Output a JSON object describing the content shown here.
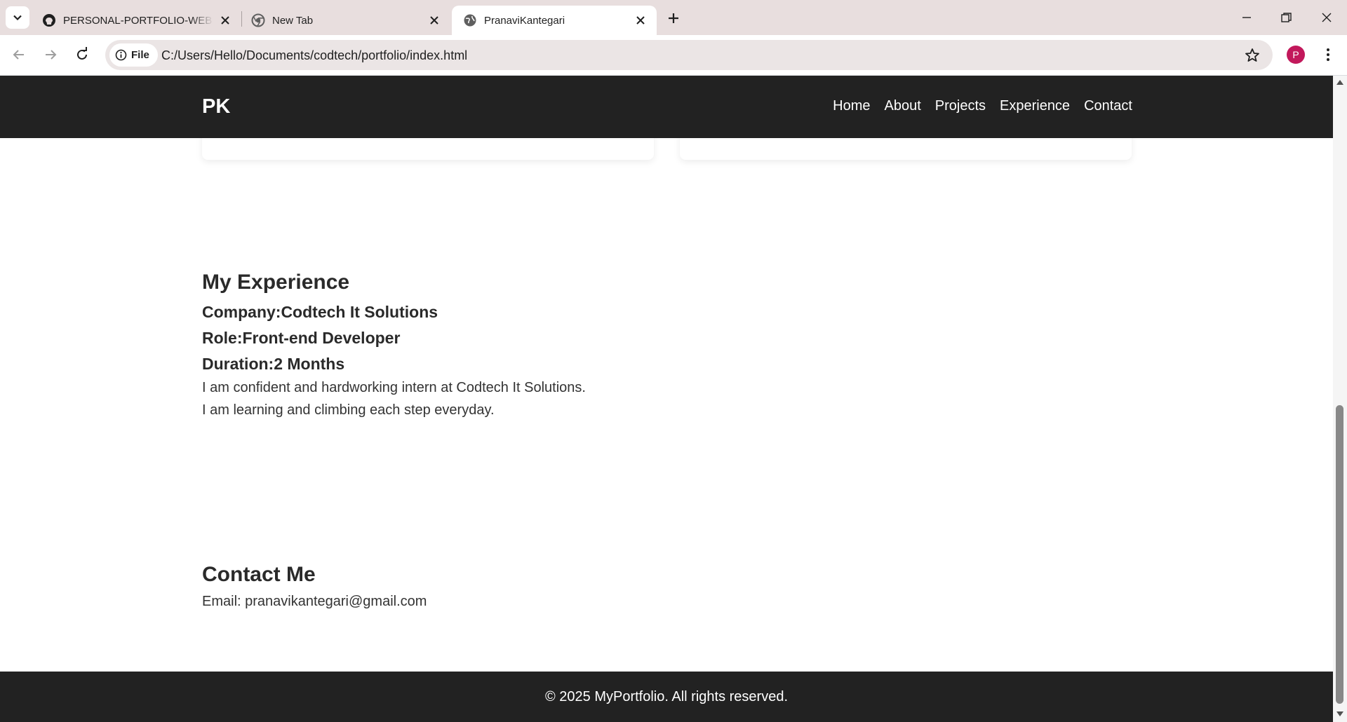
{
  "browser": {
    "tabs": [
      {
        "title": "PERSONAL-PORTFOLIO-WEBPAGE",
        "favicon": "github-icon",
        "active": false
      },
      {
        "title": "New Tab",
        "favicon": "chrome-icon",
        "active": false
      },
      {
        "title": "PranaviKantegari",
        "favicon": "globe-icon",
        "active": true
      }
    ],
    "chip_label": "File",
    "url": "C:/Users/Hello/Documents/codtech/portfolio/index.html",
    "profile_initial": "P",
    "profile_color": "#c2185b"
  },
  "site": {
    "logo": "PK",
    "nav": [
      "Home",
      "About",
      "Projects",
      "Experience",
      "Contact"
    ],
    "experience": {
      "heading": "My Experience",
      "company": "Company:Codtech It Solutions",
      "role": "Role:Front-end Developer",
      "duration": "Duration:2 Months",
      "line1": "I am confident and hardworking intern at Codtech It Solutions.",
      "line2": "I am learning and climbing each step everyday."
    },
    "contact": {
      "heading": "Contact Me",
      "email_line": "Email: pranavikantegari@gmail.com"
    },
    "footer": "© 2025 MyPortfolio. All rights reserved."
  },
  "colors": {
    "nav_bg": "#222222",
    "tabstrip_bg": "#e8dede",
    "text": "#2a2a2a"
  }
}
